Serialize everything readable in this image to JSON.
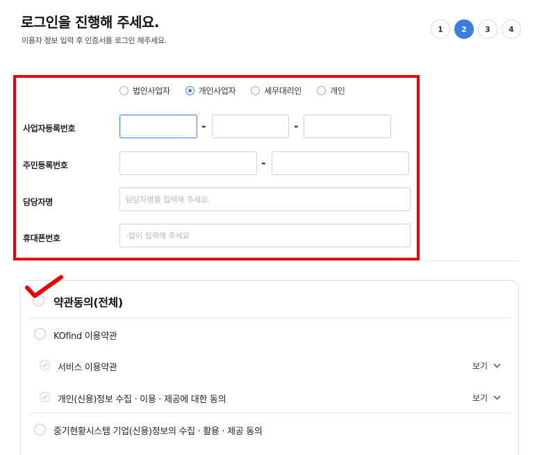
{
  "header": {
    "title": "로그인을 진행해 주세요.",
    "subtitle": "이용자 정보 입력 후 인증서를 로그인 해주세요."
  },
  "steps": [
    "1",
    "2",
    "3",
    "4"
  ],
  "active_step": "2",
  "user_type": {
    "options": [
      "법인사업자",
      "개인사업자",
      "세무대리인",
      "개인"
    ],
    "selected": "개인사업자"
  },
  "form": {
    "business_number_label": "사업자등록번호",
    "resident_number_label": "주민등록번호",
    "manager_name_label": "담당자명",
    "manager_name_placeholder": "담당자명을 입력해 주세요.",
    "phone_label": "휴대폰번호",
    "phone_placeholder": "-없이 입력해 주세요",
    "dash": "-"
  },
  "terms": {
    "all_label": "약관동의(전체)",
    "kofind_label": "KOfind 이용약관",
    "service_label": "서비스 이용약관",
    "privacy_label": "개인(신용)정보 수집 · 이용 · 제공에 대한 동의",
    "company_label": "중기현황시스템 기업(신용)정보의 수집 · 활용 · 제공 동의",
    "view_label": "보기"
  },
  "colors": {
    "accent": "#3c7de0",
    "highlight": "#ee0000"
  }
}
